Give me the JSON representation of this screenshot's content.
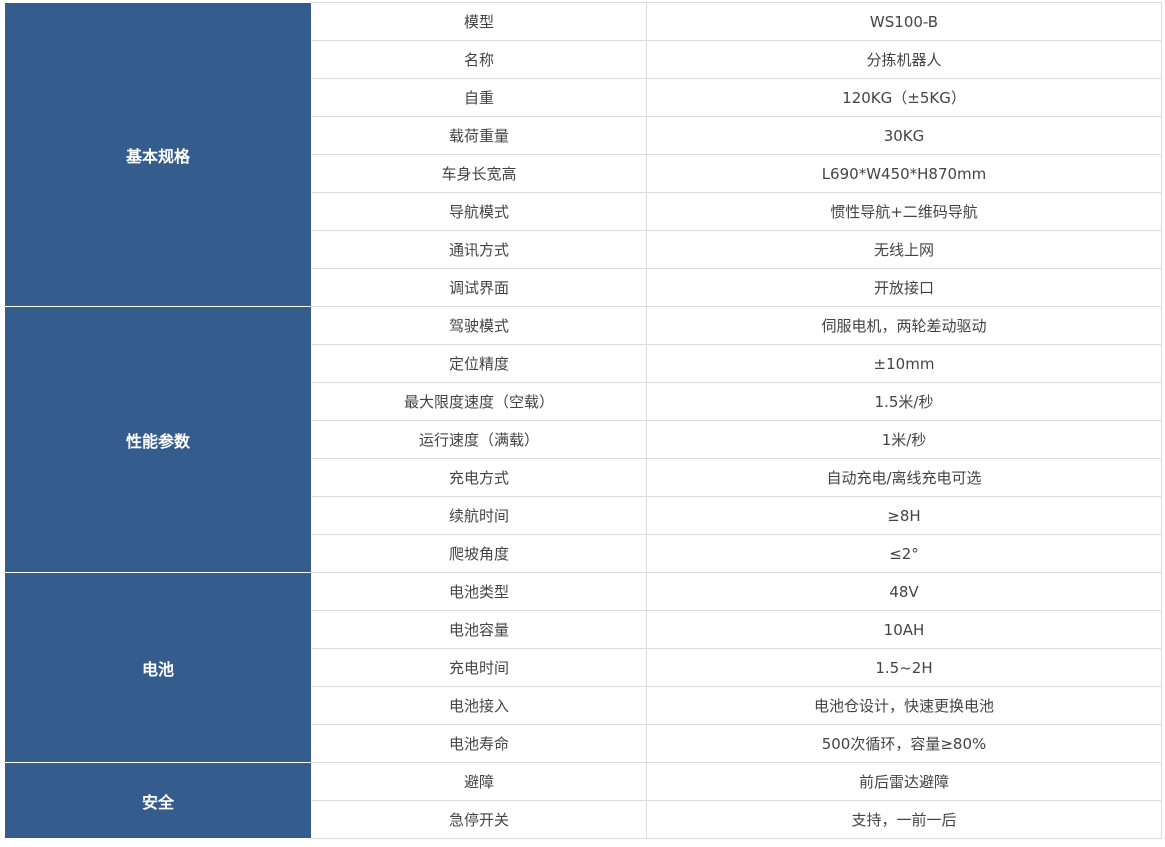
{
  "colors": {
    "category_bg": "#345d8d",
    "category_text": "#ffffff",
    "cell_text": "#444444",
    "border": "#dcdcdc"
  },
  "groups": [
    {
      "category": "基本规格",
      "rows": [
        {
          "key": "模型",
          "value": "WS100-B"
        },
        {
          "key": "名称",
          "value": "分拣机器人"
        },
        {
          "key": "自重",
          "value": "120KG（±5KG）"
        },
        {
          "key": "载荷重量",
          "value": "30KG"
        },
        {
          "key": "车身长宽高",
          "value": "L690*W450*H870mm"
        },
        {
          "key": "导航模式",
          "value": "惯性导航+二维码导航"
        },
        {
          "key": "通讯方式",
          "value": "无线上网"
        },
        {
          "key": "调试界面",
          "value": "开放接口"
        }
      ]
    },
    {
      "category": "性能参数",
      "rows": [
        {
          "key": "驾驶模式",
          "value": "伺服电机，两轮差动驱动"
        },
        {
          "key": "定位精度",
          "value": "±10mm"
        },
        {
          "key": "最大限度速度（空载）",
          "value": "1.5米/秒"
        },
        {
          "key": "运行速度（满载）",
          "value": "1米/秒"
        },
        {
          "key": "充电方式",
          "value": "自动充电/离线充电可选"
        },
        {
          "key": "续航时间",
          "value": "≥8H"
        },
        {
          "key": "爬坡角度",
          "value": "≤2°"
        }
      ]
    },
    {
      "category": "电池",
      "rows": [
        {
          "key": "电池类型",
          "value": "48V"
        },
        {
          "key": "电池容量",
          "value": "10AH"
        },
        {
          "key": "充电时间",
          "value": "1.5~2H"
        },
        {
          "key": "电池接入",
          "value": "电池仓设计，快速更换电池"
        },
        {
          "key": "电池寿命",
          "value": "500次循环，容量≥80%"
        }
      ]
    },
    {
      "category": "安全",
      "rows": [
        {
          "key": "避障",
          "value": "前后雷达避障"
        },
        {
          "key": "急停开关",
          "value": "支持，一前一后"
        }
      ]
    }
  ]
}
